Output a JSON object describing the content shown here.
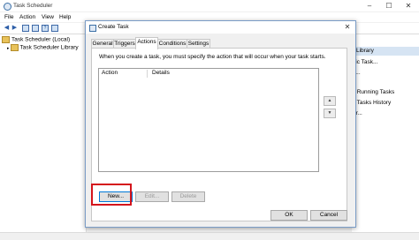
{
  "main_window": {
    "title": "Task Scheduler",
    "controls": {
      "minimize": "–",
      "maximize": "☐",
      "close": "✕"
    }
  },
  "menu": [
    "File",
    "Action",
    "View",
    "Help"
  ],
  "tree": {
    "root": "Task Scheduler (Local)",
    "child": "Task Scheduler Library"
  },
  "actions_pane": {
    "header": "r Library",
    "items": [
      "sic Task...",
      "k...",
      "",
      "ll Running Tasks",
      "ll Tasks History",
      "er...",
      "",
      "",
      "",
      "",
      ""
    ]
  },
  "dialog": {
    "title": "Create Task",
    "close": "✕",
    "tabs": [
      "General",
      "Triggers",
      "Actions",
      "Conditions",
      "Settings"
    ],
    "active_tab": "Actions",
    "description": "When you create a task, you must specify the action that will occur when your task starts.",
    "columns": [
      "Action",
      "Details"
    ],
    "buttons": {
      "new": "New...",
      "edit": "Edit...",
      "delete": "Delete"
    },
    "ok": "OK",
    "cancel": "Cancel"
  },
  "colors": {
    "highlight": "#d4141c",
    "accent": "#0078d7"
  }
}
